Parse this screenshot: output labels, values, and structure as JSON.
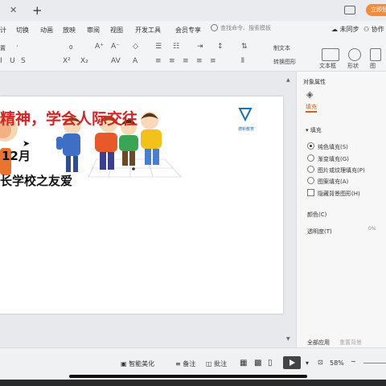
{
  "titlebar": {
    "login_label": "立即登录",
    "close_glyph": "✕",
    "add_glyph": "+"
  },
  "menu": {
    "items": [
      "计",
      "切换",
      "动画",
      "放映",
      "审阅",
      "视图",
      "开发工具",
      "会员专享"
    ],
    "search_placeholder": "查找命令、搜索模板",
    "sync_label": "未同步",
    "collab_label": "协作"
  },
  "toolbar": {
    "row1_left": "置",
    "font_size": "0",
    "new_slide_label": "文本框",
    "shape_label": "形状",
    "picture_label": "图",
    "row1_tail": "制文本",
    "row2_tail": "转换图形"
  },
  "slide": {
    "title": "精神，学会人际交往",
    "date": "12月",
    "subtitle": "长学校之友爱",
    "brand_name": "德新教育"
  },
  "pane": {
    "header": "对象属性",
    "tab_fill": "填充",
    "section_fill": "填充",
    "options": [
      {
        "label": "纯色填充(S)",
        "selected": true
      },
      {
        "label": "渐变填充(G)",
        "selected": false
      },
      {
        "label": "图片或纹理填充(P)",
        "selected": false
      },
      {
        "label": "图案填充(A)",
        "selected": false
      }
    ],
    "hide_bg_label": "隐藏背景图形(H)",
    "color_label": "颜色(C)",
    "transparency_label": "透明度(T)",
    "transparency_value": "0%",
    "apply_all_label": "全部应用",
    "reset_bg_label": "重置背景"
  },
  "statusbar": {
    "smart_beautify": "智能美化",
    "notes": "备注",
    "comments": "批注",
    "zoom": "58%"
  },
  "colors": {
    "accent_orange": "#f28c3b",
    "title_red": "#d42525",
    "brand_blue": "#1b6fb3"
  }
}
